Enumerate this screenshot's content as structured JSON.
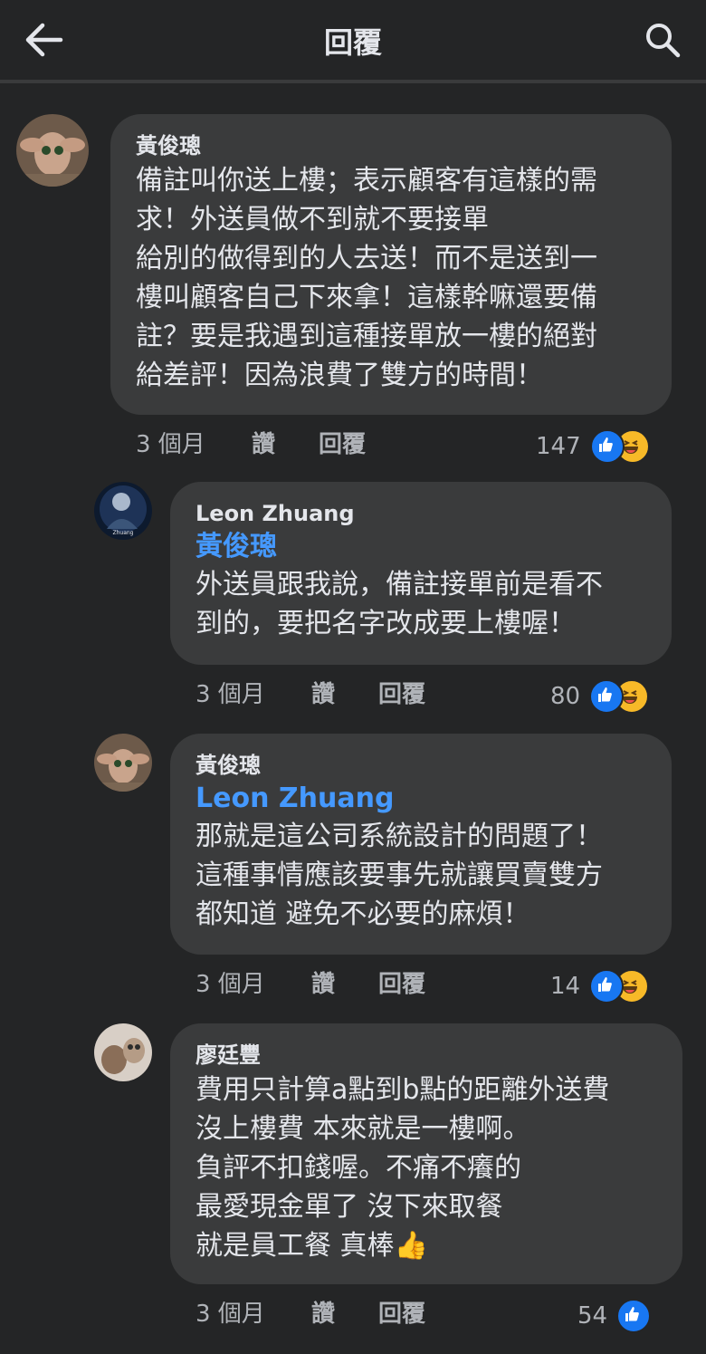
{
  "header": {
    "title": "回覆"
  },
  "comments": [
    {
      "author": "黃俊璁",
      "mention": "",
      "text": "備註叫你送上樓；表示顧客有這樣的需\n求！外送員做不到就不要接單\n給別的做得到的人去送！而不是送到一\n樓叫顧客自己下來拿！這樣幹嘛還要備\n註？要是我遇到這種接單放一樓的絕對\n給差評！因為浪費了雙方的時間！",
      "time": "3 個月",
      "like": "讚",
      "reply": "回覆",
      "count": "147",
      "reactions": [
        "like-icon",
        "haha-icon"
      ]
    },
    {
      "author": "Leon Zhuang",
      "mention": "黃俊璁",
      "text": "外送員跟我說，備註接單前是看不\n到的，要把名字改成要上樓喔！",
      "time": "3 個月",
      "like": "讚",
      "reply": "回覆",
      "count": "80",
      "reactions": [
        "like-icon",
        "haha-icon"
      ]
    },
    {
      "author": "黃俊璁",
      "mention": "Leon Zhuang",
      "text": "那就是這公司系統設計的問題了！\n這種事情應該要事先就讓買賣雙方\n都知道 避免不必要的麻煩！",
      "time": "3 個月",
      "like": "讚",
      "reply": "回覆",
      "count": "14",
      "reactions": [
        "like-icon",
        "haha-icon"
      ]
    },
    {
      "author": "廖廷豐",
      "mention": "",
      "text": "費用只計算a點到b點的距離外送費\n沒上樓費 本來就是一樓啊。\n負評不扣錢喔。不痛不癢的\n最愛現金單了 沒下來取餐\n就是員工餐 真棒👍",
      "time": "3 個月",
      "like": "讚",
      "reply": "回覆",
      "count": "54",
      "reactions": [
        "like-icon"
      ]
    }
  ],
  "colors": {
    "background": "#242526",
    "bubble": "#3a3b3c",
    "mention": "#4599ff",
    "like": "#1877f2",
    "haha": "#f7b928"
  }
}
